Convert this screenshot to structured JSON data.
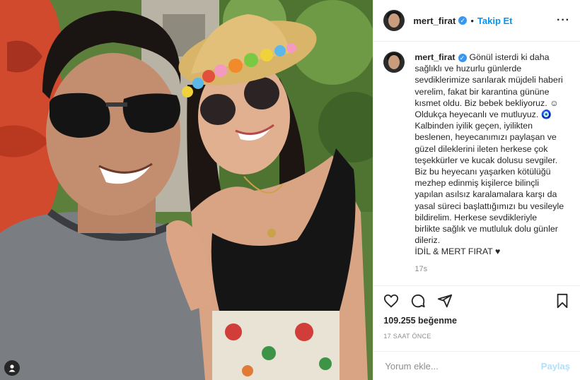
{
  "header": {
    "username": "mert_firat",
    "verified_icon": "verified-badge-icon",
    "separator": "•",
    "follow_label": "Takip Et",
    "more_icon": "more-options-icon"
  },
  "caption": {
    "username": "mert_firat",
    "lines": [
      "Gönül isterdi ki daha",
      "sağlıklı ve huzurlu günlerde",
      "sevdiklerimize sarılarak müjdeli haberi",
      "verelim, fakat bir karantina gününe",
      "kısmet oldu. Biz bebek bekliyoruz. ☺",
      "Oldukça heyecanlı ve mutluyuz. 🧿",
      "Kalbinden iyilik geçen, iyilikten",
      "beslenen, heyecanımızı paylaşan ve",
      "güzel dileklerini ileten herkese çok",
      "teşekkürler ve kucak dolusu sevgiler.",
      "Biz bu heyecanı yaşarken kötülüğü",
      "mezhep edinmiş kişilerce bilinçli",
      "yapılan asılsız karalamalara karşı da",
      "yasal süreci başlattığımızı bu vesileyle",
      "bildirelim. Herkese sevdikleriyle",
      "birlikte sağlık ve mutluluk dolu günler",
      "dileriz.",
      "İDİL & MERT FIRAT ♥"
    ],
    "time": "17s"
  },
  "actions": {
    "like_icon": "heart-icon",
    "comment_icon": "comment-icon",
    "share_icon": "share-icon",
    "save_icon": "bookmark-icon"
  },
  "likes": "109.255 beğenme",
  "date": "17 SAAT ÖNCE",
  "comment": {
    "placeholder": "Yorum ekle...",
    "post_label": "Paylaş"
  },
  "photo": {
    "tag_icon": "user-tag-icon"
  }
}
